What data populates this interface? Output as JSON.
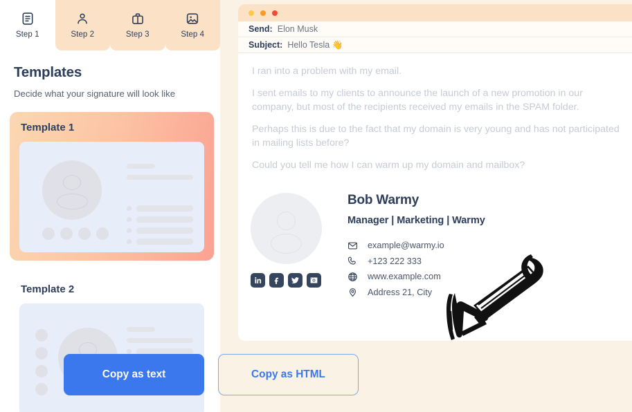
{
  "theme": {
    "background": "#faf2e4",
    "accent_blue": "#3b77ed",
    "navy": "#2d3e5b",
    "peach": "#fbe2c6",
    "template_gradient_from": "#fbd7b2",
    "template_gradient_to": "#fba292",
    "wireframe_panel": "#e8edfa",
    "social_icon_bg": "#36455e"
  },
  "sidebar": {
    "steps": [
      {
        "label": "Step 1",
        "icon": "document-icon",
        "active": true
      },
      {
        "label": "Step 2",
        "icon": "person-icon",
        "active": false
      },
      {
        "label": "Step 3",
        "icon": "briefcase-icon",
        "active": false
      },
      {
        "label": "Step 4",
        "icon": "image-icon",
        "active": false
      }
    ],
    "section_title": "Templates",
    "section_subtitle": "Decide what your signature will look like",
    "templates": [
      {
        "label": "Template 1",
        "selected": true,
        "layout": "avatar-left-socials-below"
      },
      {
        "label": "Template 2",
        "selected": false,
        "layout": "socials-left-avatar-center"
      }
    ]
  },
  "mail": {
    "window_dots": [
      "#fcc94f",
      "#f99a2b",
      "#f24a34"
    ],
    "fields": [
      {
        "label": "Send:",
        "value": "Elon Musk"
      },
      {
        "label": "Subject:",
        "value": "Hello Tesla 👋"
      }
    ],
    "paragraphs": [
      "I ran into a problem with my email.",
      "I sent emails to my clients to announce the launch of a new promotion in our company, but most of the recipients received my emails in the SPAM folder.",
      "Perhaps this is due to the fact that my domain is very young and has not participated in mailing lists before?",
      "Could you tell me how I can warm up my domain and mailbox?"
    ],
    "signature": {
      "name": "Bob Warmy",
      "role": "Manager | Marketing | Warmy",
      "contacts": [
        {
          "icon": "envelope-icon",
          "text": "example@warmy.io"
        },
        {
          "icon": "phone-icon",
          "text": "+123 222 333"
        },
        {
          "icon": "globe-icon",
          "text": "www.example.com"
        },
        {
          "icon": "location-pin-icon",
          "text": "Address 21, City"
        }
      ],
      "socials": [
        "linkedin-icon",
        "facebook-icon",
        "twitter-icon",
        "instagram-icon"
      ]
    }
  },
  "actions": {
    "copy_text_label": "Copy as text",
    "copy_html_label": "Copy as HTML"
  }
}
